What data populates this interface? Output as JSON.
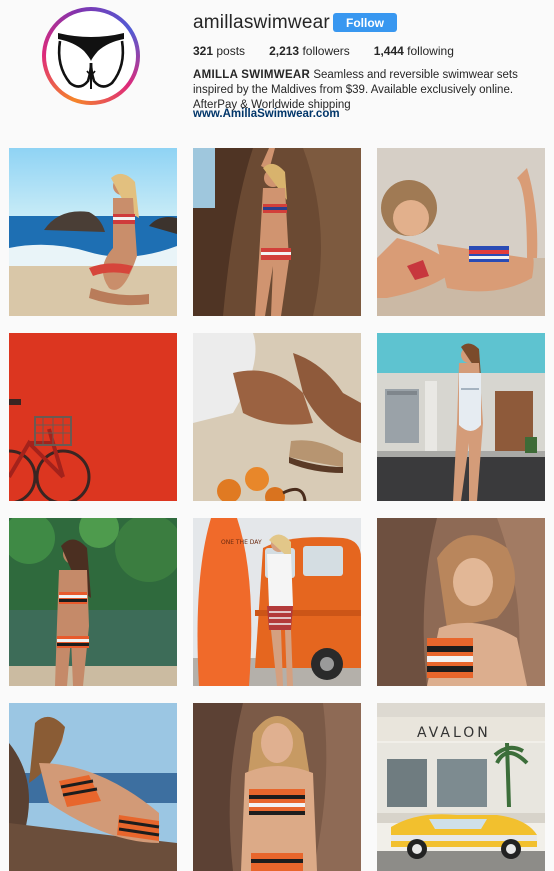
{
  "profile": {
    "username": "amillaswimwear",
    "follow_label": "Follow",
    "stats": {
      "posts_count": "321",
      "posts_label": "posts",
      "followers_count": "2,213",
      "followers_label": "followers",
      "following_count": "1,444",
      "following_label": "following"
    },
    "bio_name": "AMILLA SWIMWEAR",
    "bio_text": "Seamless and reversible swimwear sets inspired by the Maldives from $39. Available exclusively online. AfterPay & Worldwide shipping",
    "website": "www.AmillaSwimwear.com"
  },
  "posts": [
    {
      "subject": "beach-rocks-striped-bikini"
    },
    {
      "subject": "rock-cliff-striped-bikini"
    },
    {
      "subject": "lying-on-sand-striped-bikini"
    },
    {
      "subject": "red-wall-bicycle"
    },
    {
      "subject": "sand-legs-oranges"
    },
    {
      "subject": "street-white-swimsuit"
    },
    {
      "subject": "river-striped-bikini"
    },
    {
      "subject": "orange-van-surfboard",
      "text": "ONE THE DAY"
    },
    {
      "subject": "rock-orange-stripe-top"
    },
    {
      "subject": "rock-lying-orange-stripe-bikini"
    },
    {
      "subject": "rock-standing-orange-stripe-bikini"
    },
    {
      "subject": "avalon-building-yellow-car",
      "text": "AVALON"
    }
  ]
}
